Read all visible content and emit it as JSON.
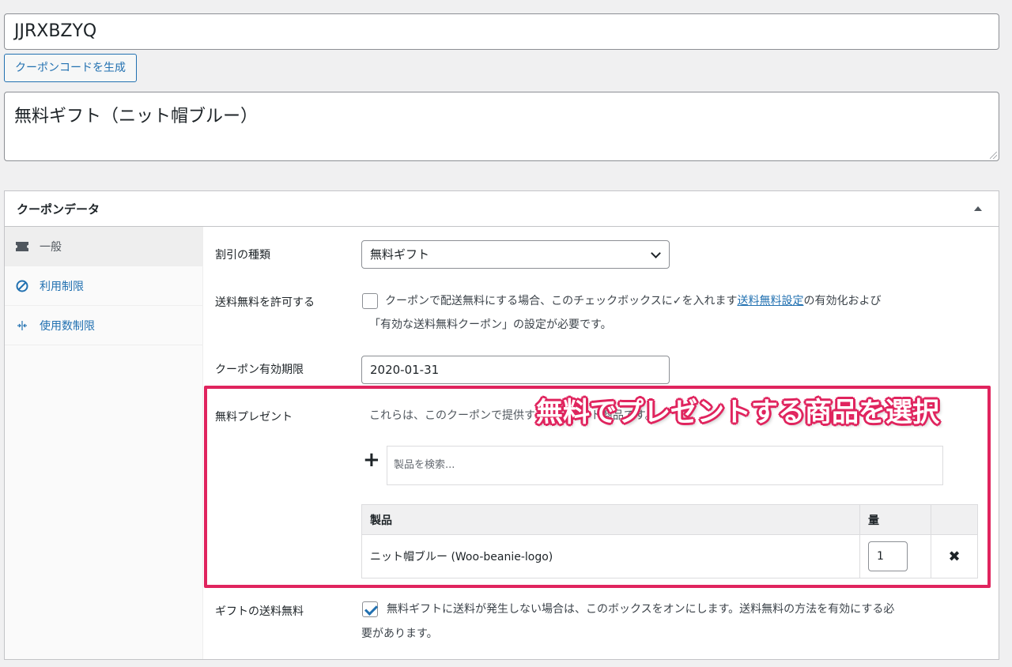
{
  "coupon": {
    "code": "JJRXBZYQ",
    "generate_label": "クーポンコードを生成",
    "description": "無料ギフト（ニット帽ブルー）"
  },
  "panel": {
    "title": "クーポンデータ"
  },
  "tabs": [
    {
      "label": "一般",
      "icon": "ticket-icon"
    },
    {
      "label": "利用制限",
      "icon": "ban-icon"
    },
    {
      "label": "使用数制限",
      "icon": "arrows-icon"
    }
  ],
  "form": {
    "discount_type_label": "割引の種類",
    "discount_type_value": "無料ギフト",
    "free_shipping_label": "送料無料を許可する",
    "free_shipping_text_1": "クーポンで配送無料にする場合、このチェックボックスに✓を入れます",
    "free_shipping_link": "送料無料設定",
    "free_shipping_text_2": "の有効化および",
    "free_shipping_text_3": "「有効な送料無料クーポン」の設定が必要です。",
    "expiry_label": "クーポン有効期限",
    "expiry_value": "2020-01-31",
    "gift_label": "無料プレゼント",
    "gift_desc": "これらは、このクーポンで提供する無料ギフト商品です。",
    "search_placeholder": "製品を検索...",
    "table": {
      "col_product": "製品",
      "col_qty": "量",
      "rows": [
        {
          "product": "ニット帽ブルー (Woo-beanie-logo)",
          "qty": "1"
        }
      ]
    },
    "gift_shipping_label": "ギフトの送料無料",
    "gift_shipping_text_1": "無料ギフトに送料が発生しない場合は、このボックスをオンにします。送料無料の方法を有効にする必",
    "gift_shipping_text_2": "要があります。"
  },
  "annotation": {
    "callout": "無料でプレゼントする商品を選択",
    "color": "#e0245e"
  }
}
